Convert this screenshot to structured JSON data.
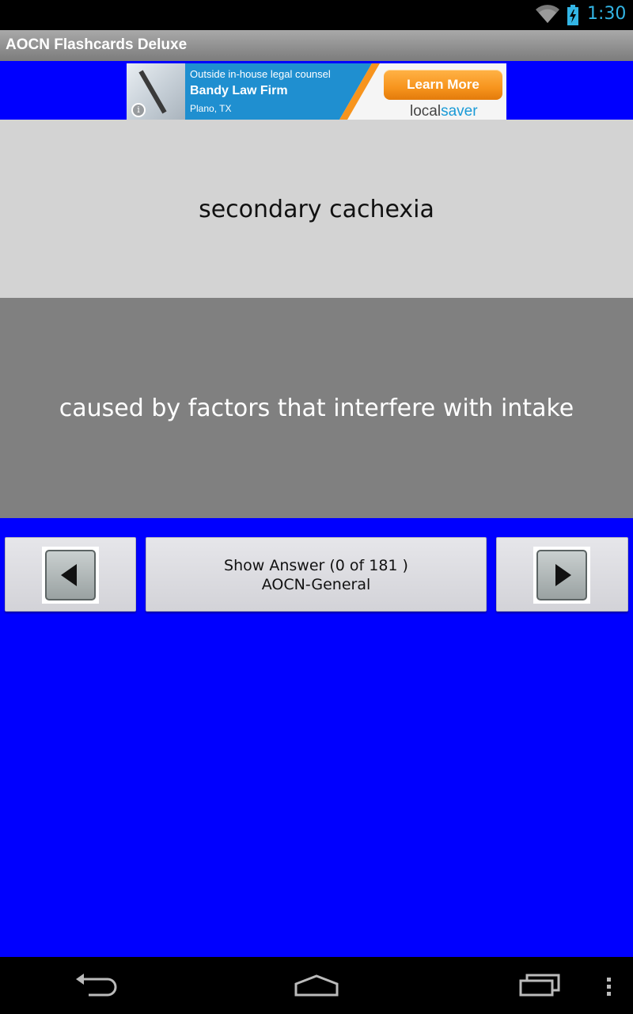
{
  "status_bar": {
    "time": "1:30",
    "icons": [
      "wifi-icon",
      "battery-charging-icon"
    ],
    "clock_color": "#33b5e5"
  },
  "app": {
    "title": "AOCN Flashcards Deluxe"
  },
  "ad": {
    "line1": "Outside in-house legal counsel",
    "firm": "Bandy Law Firm",
    "location": "Plano, TX",
    "cta": "Learn More",
    "brand_prefix": "local",
    "brand_suffix": "saver",
    "icons": [
      "info-icon"
    ]
  },
  "card": {
    "question": "secondary cachexia",
    "answer": "caused by factors that interfere with intake"
  },
  "controls": {
    "show_answer_label": "Show Answer  (0 of 181 )",
    "deck_name": "AOCN-General",
    "icons": [
      "previous-arrow-icon",
      "next-arrow-icon"
    ]
  },
  "nav_bar": {
    "icons": [
      "back-icon",
      "home-icon",
      "recent-apps-icon",
      "menu-overflow-icon"
    ]
  },
  "colors": {
    "background": "#0000ff",
    "question_panel": "#d3d3d3",
    "answer_panel": "#808080",
    "cta": "#f7941d"
  }
}
